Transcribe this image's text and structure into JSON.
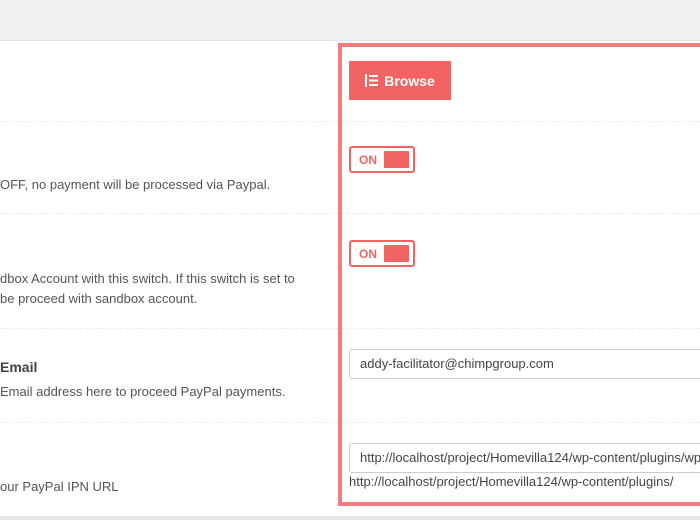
{
  "logo_upload": {
    "browse_label": "Browse",
    "browse_icon": "list-icon"
  },
  "paypal_enable": {
    "description": "OFF, no payment will be processed via Paypal.",
    "toggle_state": "ON"
  },
  "sandbox": {
    "description_line1": "dbox Account with this switch. If this switch is set to",
    "description_line2": "be proceed with sandbox account.",
    "toggle_state": "ON"
  },
  "paypal_email": {
    "label": "Email",
    "description": "Email address here to proceed PayPal payments.",
    "value": "addy-facilitator@chimpgroup.com"
  },
  "ipn_url": {
    "description": "our PayPal IPN URL",
    "value": "http://localhost/project/Homevilla124/wp-content/plugins/wp",
    "display_text": "http://localhost/project/Homevilla124/wp-content/plugins/"
  },
  "colors": {
    "accent": "#f26464",
    "highlight_border": "#f47c7c"
  }
}
